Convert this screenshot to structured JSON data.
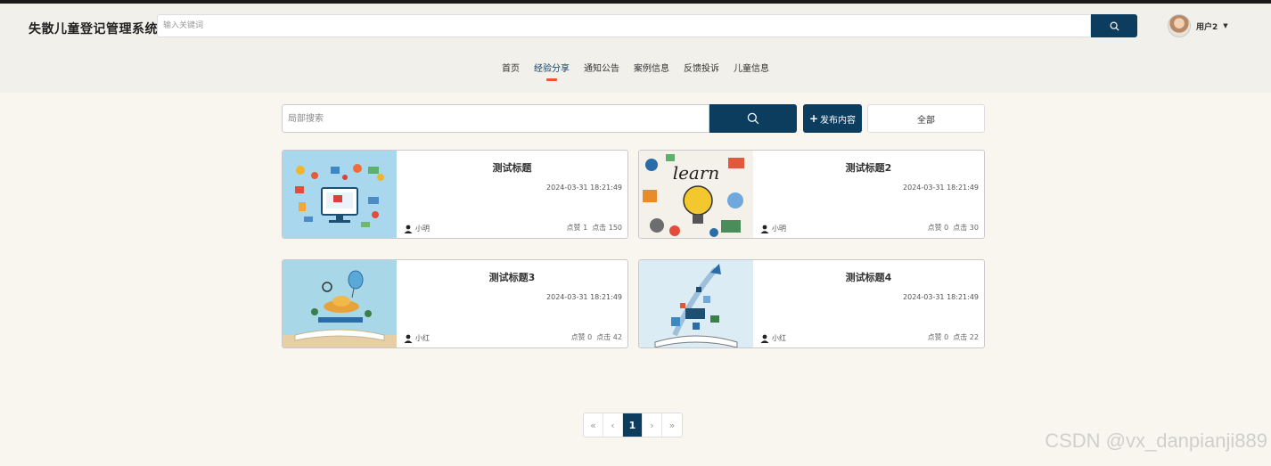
{
  "header": {
    "brand": "失散儿童登记管理系统",
    "search_placeholder": "输入关键词",
    "user_name": "用户2"
  },
  "nav": {
    "items": [
      "首页",
      "经验分享",
      "通知公告",
      "案例信息",
      "反馈投诉",
      "儿童信息"
    ],
    "active": "经验分享"
  },
  "toolbar": {
    "local_search_placeholder": "局部搜索",
    "publish_label": "发布内容",
    "all_label": "全部"
  },
  "cards": [
    {
      "title": "测试标题",
      "date": "2024-03-31 18:21:49",
      "author": "小明",
      "likes": "点赞 1",
      "clicks": "点击 150"
    },
    {
      "title": "测试标题2",
      "date": "2024-03-31 18:21:49",
      "author": "小明",
      "likes": "点赞 0",
      "clicks": "点击 30"
    },
    {
      "title": "测试标题3",
      "date": "2024-03-31 18:21:49",
      "author": "小红",
      "likes": "点赞 0",
      "clicks": "点击 42"
    },
    {
      "title": "测试标题4",
      "date": "2024-03-31 18:21:49",
      "author": "小红",
      "likes": "点赞 0",
      "clicks": "点击 22"
    }
  ],
  "pagination": {
    "first": "«",
    "prev": "‹",
    "current": "1",
    "next": "›",
    "last": "»"
  },
  "watermark": "CSDN @vx_danpianji889",
  "colors": {
    "primary": "#0c3d5e",
    "accent": "#e8582a",
    "background": "#f8f6ee",
    "header_bg": "#f2f0ea"
  }
}
